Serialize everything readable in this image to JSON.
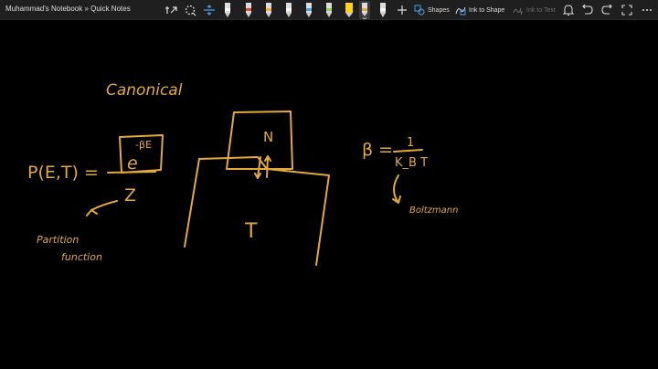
{
  "app": {
    "title": "Muhammad's Notebook » Quick Notes"
  },
  "toolbar": {
    "shapes_label": "Shapes",
    "ink_to_shape_label": "Ink to Shape",
    "ink_to_text_label": "Ink to Text",
    "pen_colors": [
      "#ffffff",
      "#e8403c",
      "#f2b233",
      "#ffffff",
      "#47a6e8",
      "#9bd13d",
      "#ffd21f",
      "#ffffff",
      "#ffffff",
      "#e3a93d",
      "#ffffff"
    ],
    "ink_color": "#e3a93d"
  },
  "canvas": {
    "heading": "Canonical",
    "equation_lhs": "P(E,T) =",
    "exp_base": "e",
    "exp_power": "-βE",
    "sum_label": "Z",
    "partition_note_1": "Partition",
    "partition_note_2": "function",
    "beta_label": "β =",
    "beta_numerator": "1",
    "beta_denominator": "K_B T",
    "boltzmann_note": "Boltzmann",
    "system_label": "N",
    "reservoir_label": "T"
  }
}
